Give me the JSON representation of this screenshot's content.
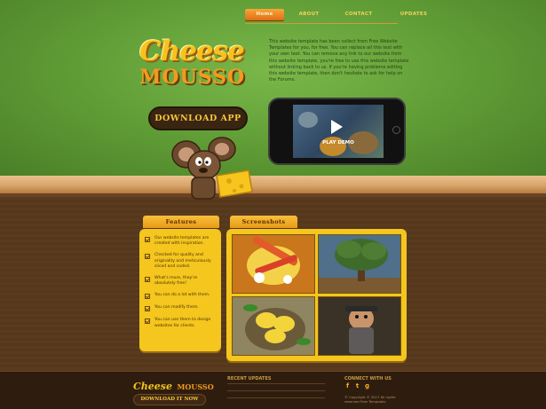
{
  "nav": {
    "items": [
      "Home",
      "ABOUT",
      "CONTACT",
      "UPDATES"
    ],
    "active": "Home"
  },
  "logo": {
    "line1": "Cheese",
    "line2": "MOUSSO"
  },
  "hero": {
    "download_label": "DOWNLOAD APP",
    "intro": "This website template has been collect from Free Website Templates for you, for free. You can replace all this text with your own text. You can remove any link to our website from this website template, you're free to use this website template without linking back to us. If you're having problems editing this website template, then don't hesitate to ask for help on the Forums.",
    "play_label": "PLAY DEMO"
  },
  "features": {
    "title": "Features",
    "items": [
      "Our website templates are created with inspiration.",
      "Checked for quality and originality and meticulously sliced and coded.",
      "What's more, they're absolutely free!",
      "You can do a lot with them.",
      "You can modify them.",
      "You can use them to design websites for clients."
    ]
  },
  "screenshots": {
    "title": "Screenshots"
  },
  "footer": {
    "logo_line1": "Cheese",
    "logo_line2": "MOUSSO",
    "download_label": "DOWNLOAD IT NOW",
    "recent_title": "RECENT UPDATES",
    "connect_title": "CONNECT WITH US",
    "social": [
      "f",
      "t",
      "g"
    ],
    "copyright": "© Copyright © 2017 All rights reserved Free Templates"
  },
  "colors": {
    "accent": "#f4c61e",
    "nav_active": "#de6e14",
    "brand_text": "#f5c63a"
  },
  "icons": [
    "play-icon",
    "facebook-icon",
    "twitter-icon",
    "googleplus-icon",
    "checkbox-icon"
  ]
}
